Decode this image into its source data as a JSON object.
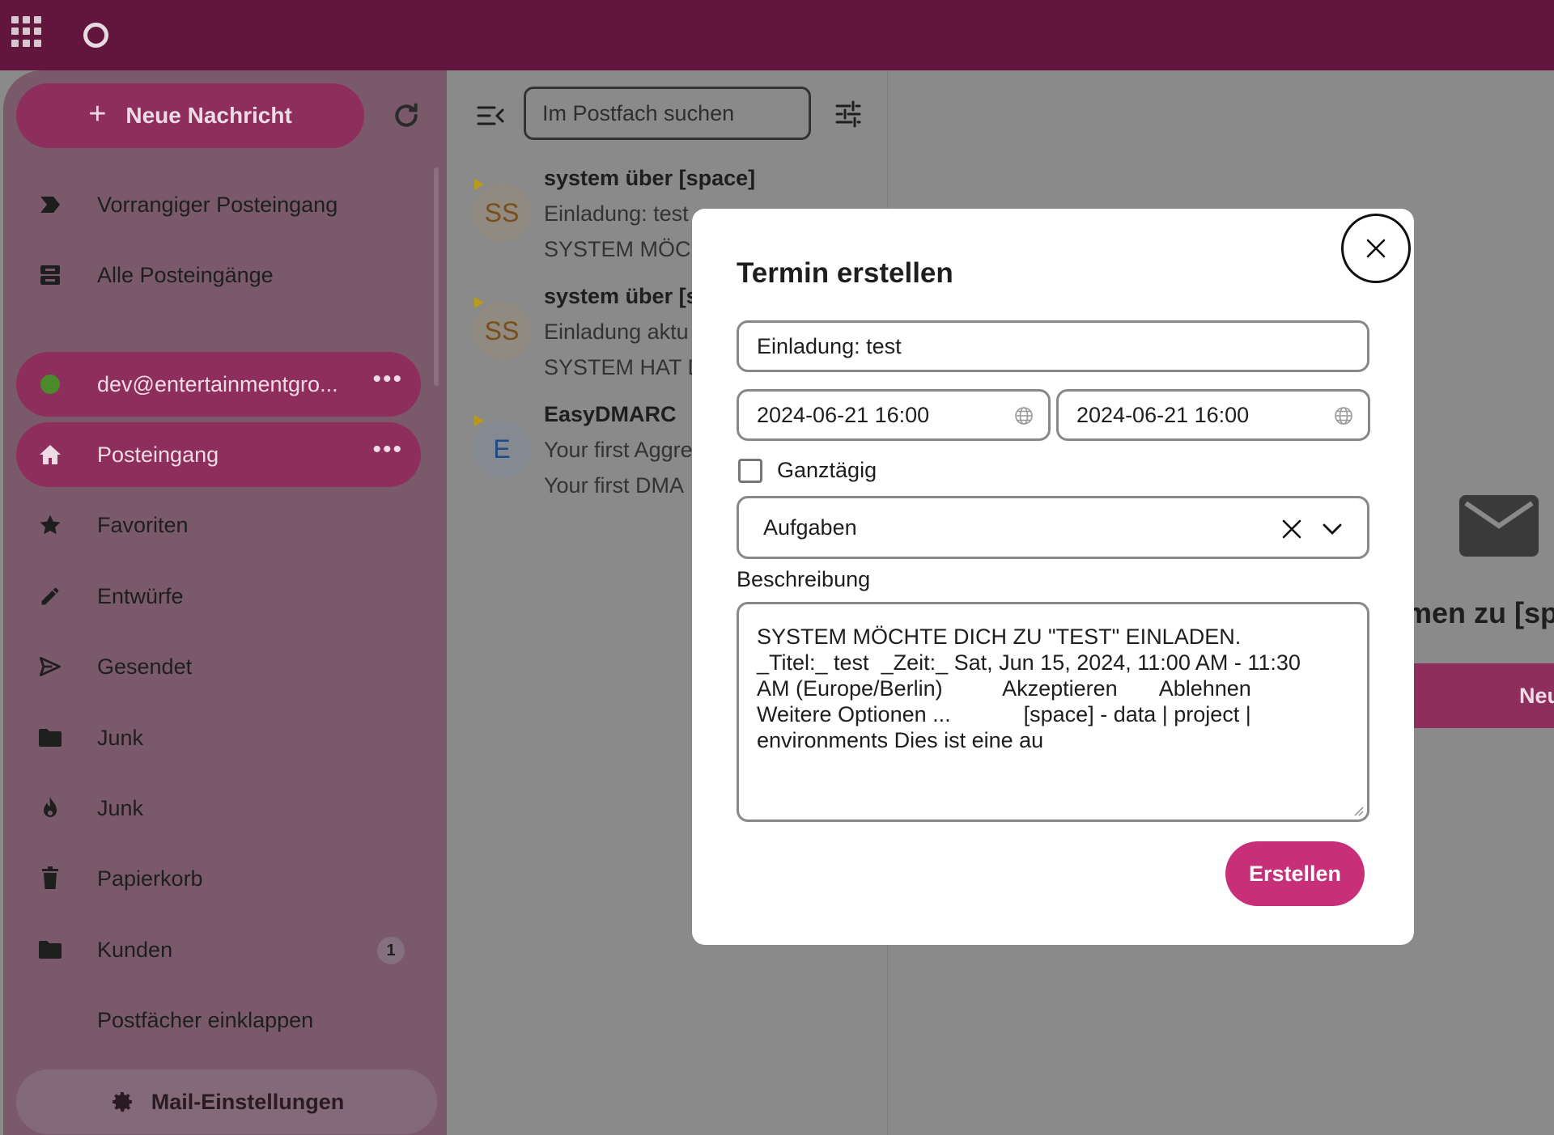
{
  "header": {
    "apps_icon": "apps-grid-icon",
    "logo_icon": "app-logo-icon"
  },
  "sidebar": {
    "new_message_label": "Neue Nachricht",
    "items": [
      {
        "label": "Vorrangiger Posteingang",
        "icon": "priority-icon"
      },
      {
        "label": "Alle Posteingänge",
        "icon": "inboxes-icon"
      },
      {
        "label": "dev@entertainmentgro...",
        "icon": "status-dot"
      },
      {
        "label": "Posteingang",
        "icon": "home-icon"
      },
      {
        "label": "Favoriten",
        "icon": "star-icon"
      },
      {
        "label": "Entwürfe",
        "icon": "pencil-icon"
      },
      {
        "label": "Gesendet",
        "icon": "send-icon"
      },
      {
        "label": "Junk",
        "icon": "folder-icon"
      },
      {
        "label": "Junk",
        "icon": "fire-icon"
      },
      {
        "label": "Papierkorb",
        "icon": "trash-icon"
      },
      {
        "label": "Kunden",
        "icon": "folder-icon",
        "badge": "1"
      },
      {
        "label": "Postfächer einklappen"
      }
    ],
    "settings_label": "Mail-Einstellungen"
  },
  "message_list": {
    "search_placeholder": "Im Postfach suchen",
    "messages": [
      {
        "from": "system über [space]",
        "subject": "Einladung: test",
        "preview": "SYSTEM MÖCH",
        "avatar": "SS"
      },
      {
        "from": "system über [s",
        "subject": "Einladung aktu",
        "preview": "SYSTEM HAT D",
        "avatar": "SS"
      },
      {
        "from": "EasyDMARC",
        "subject": "Your first Aggre",
        "preview": "Your first DMA",
        "avatar": "E"
      }
    ]
  },
  "content": {
    "empty_text": "men zu [sp",
    "new_message_label": "Neue Nach"
  },
  "modal": {
    "title": "Termin erstellen",
    "event_title": "Einladung: test",
    "start": "2024-06-21 16:00",
    "end": "2024-06-21 16:00",
    "all_day_label": "Ganztägig",
    "all_day_checked": false,
    "calendar": "Aufgaben",
    "description_label": "Beschreibung",
    "description": "SYSTEM MÖCHTE DICH ZU \"TEST\" EINLADEN.\n_Titel:_ test  _Zeit:_ Sat, Jun 15, 2024, 11:00 AM - 11:30\nAM (Europe/Berlin)          Akzeptieren       Ablehnen\nWeitere Optionen ...            [space] - data | project |\nenvironments Dies ist eine au",
    "create_label": "Erstellen"
  },
  "colors": {
    "header": "#63163d",
    "accent": "#8e2e5c",
    "primary_button": "#c72f78",
    "overlay": "#8a8a8a"
  }
}
